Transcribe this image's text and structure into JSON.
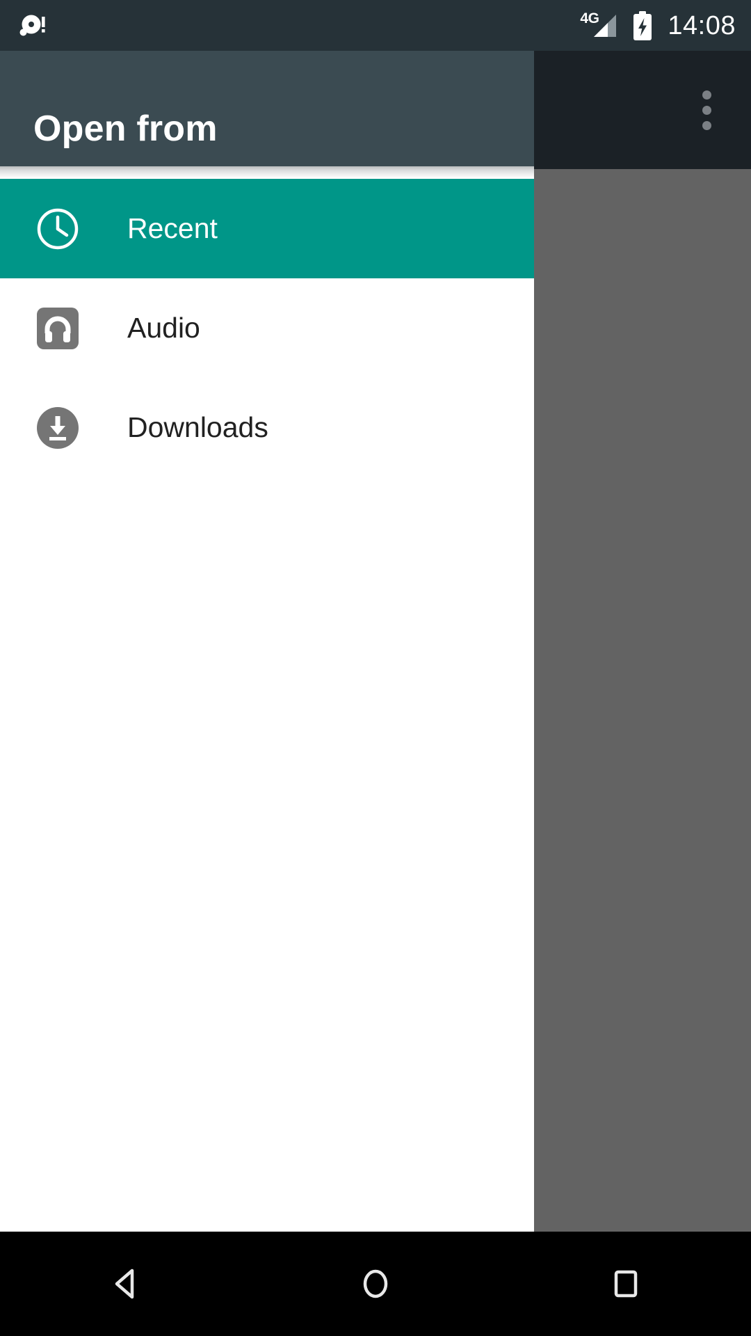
{
  "status_bar": {
    "notification_icon": "alert-disc-icon",
    "network_label": "4G",
    "signal_icon": "signal-bars-icon",
    "battery_icon": "battery-charging-icon",
    "clock": "14:08",
    "background_color": "#263238"
  },
  "app_bar": {
    "title": "Open from",
    "overflow_icon": "more-vert-icon",
    "background_color": "#3b4b52",
    "dimmed_background_color": "#1b2126"
  },
  "drawer": {
    "background_color": "#ffffff",
    "selected_color": "#009688",
    "items": [
      {
        "label": "Recent",
        "icon": "clock-icon",
        "selected": true,
        "icon_style": "outline"
      },
      {
        "label": "Audio",
        "icon": "headphones-icon",
        "selected": false,
        "icon_style": "rounded-square"
      },
      {
        "label": "Downloads",
        "icon": "download-icon",
        "selected": false,
        "icon_style": "circle"
      }
    ]
  },
  "scrim": {
    "color": "#636363"
  },
  "nav_bar": {
    "background_color": "#000000",
    "buttons": [
      {
        "name": "back",
        "icon": "back-triangle-icon"
      },
      {
        "name": "home",
        "icon": "home-circle-icon"
      },
      {
        "name": "recents",
        "icon": "recents-square-icon"
      }
    ]
  }
}
